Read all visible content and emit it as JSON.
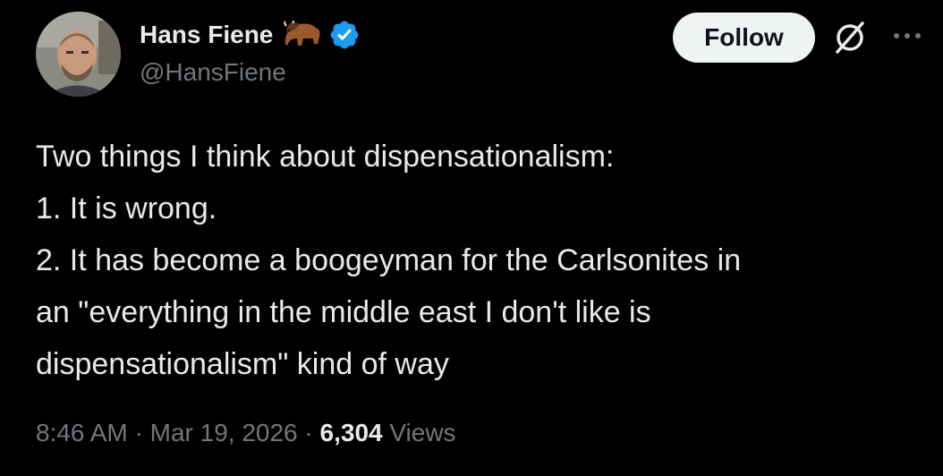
{
  "author": {
    "display_name": "Hans Fiene",
    "handle": "@HansFiene"
  },
  "icons": {
    "bison": "bison-emoji-icon",
    "verified": "verified-badge-icon",
    "grok": "grok-icon",
    "more": "more-icon"
  },
  "actions": {
    "follow_label": "Follow"
  },
  "tweet": {
    "lines": [
      "Two things I think about dispensationalism:",
      "1. It is wrong.",
      "2. It has become a boogeyman for the Carlsonites in",
      "an \"everything in the middle east I don't like is",
      "dispensationalism\" kind of way"
    ]
  },
  "meta": {
    "time": "8:46 AM",
    "separator": "·",
    "date": "Mar 19, 2026",
    "views_count": "6,304",
    "views_label": "Views"
  },
  "colors": {
    "background": "#000000",
    "primary_text": "#e7e9ea",
    "secondary_text": "#71767b",
    "verified_blue": "#1d9bf0",
    "follow_bg": "#eff3f4"
  }
}
